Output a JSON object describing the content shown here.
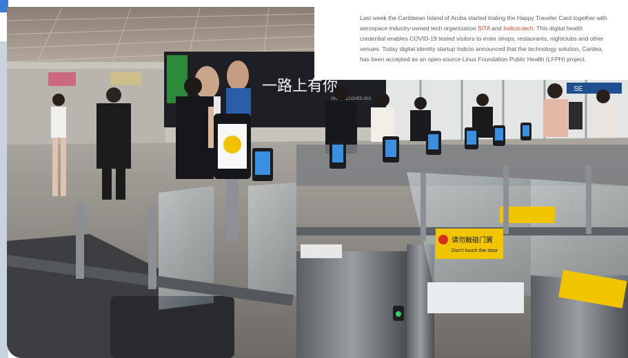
{
  "article": {
    "text_1": "Last week the Caribbean Island of Aruba started trialing the Happy Traveler Card together with aerospace industry-owned tech organization ",
    "link_sita": "SITA",
    "text_2": " and ",
    "link_indicio": "Indicio.tech",
    "text_3": ". This digital health credential enables COVID-19 tested visitors to enter shops, restaurants, nightclubs and other venues. Today digital identity startup Indicio announced that the technology solution, Cardea, has been accepted as an open-source Linux Foundation Public Health (LFPH) project.",
    "link_color": "#e0402e"
  },
  "photo_signs": {
    "chinese_warning": "请勿触碰门翼",
    "english_warning": "Don't touch the door",
    "overhead_sign": "SE",
    "billboard_text": "一路上有你",
    "billboard_tagline": "ONLY BELOVED GUI"
  }
}
